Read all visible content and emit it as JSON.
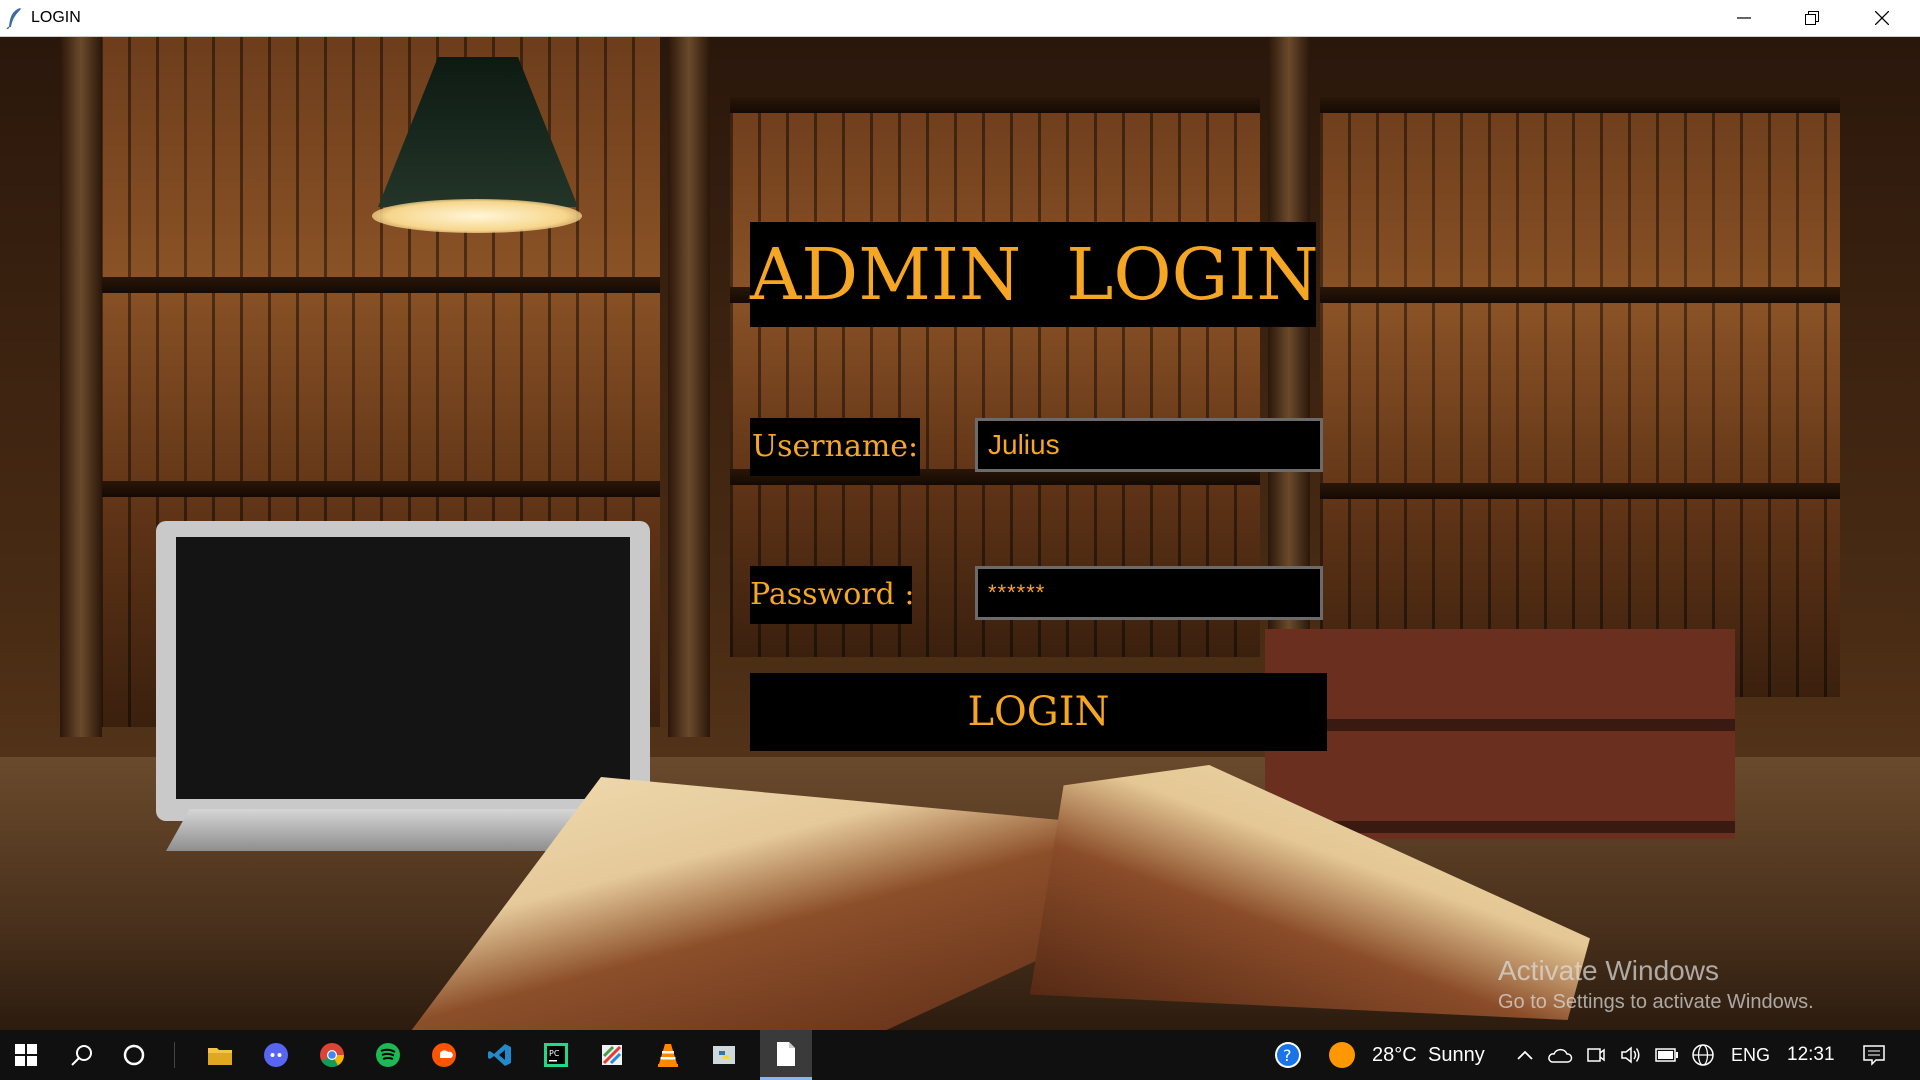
{
  "window": {
    "title": "LOGIN",
    "controls": [
      "minimize",
      "restore",
      "close"
    ]
  },
  "login": {
    "heading": "ADMIN  LOGIN",
    "username_label": "Username:",
    "username_value": "Julius",
    "password_label": "Password :",
    "password_value": "******",
    "login_button": "LOGIN"
  },
  "colors": {
    "accent": "#f5a623",
    "panel": "#000000"
  },
  "watermark": {
    "line1": "Activate Windows",
    "line2": "Go to Settings to activate Windows."
  },
  "taskbar": {
    "apps": [
      "start-icon",
      "search-icon",
      "cortana-icon",
      "file-explorer-icon",
      "discord-icon",
      "chrome-icon",
      "spotify-icon",
      "soundcloud-icon",
      "vscode-icon",
      "pycharm-icon",
      "paint-app-icon",
      "vlc-icon",
      "python-idle-icon",
      "notepad-icon"
    ],
    "weather": {
      "temperature": "28°C",
      "condition": "Sunny"
    },
    "language": "ENG",
    "time": "12:31"
  }
}
